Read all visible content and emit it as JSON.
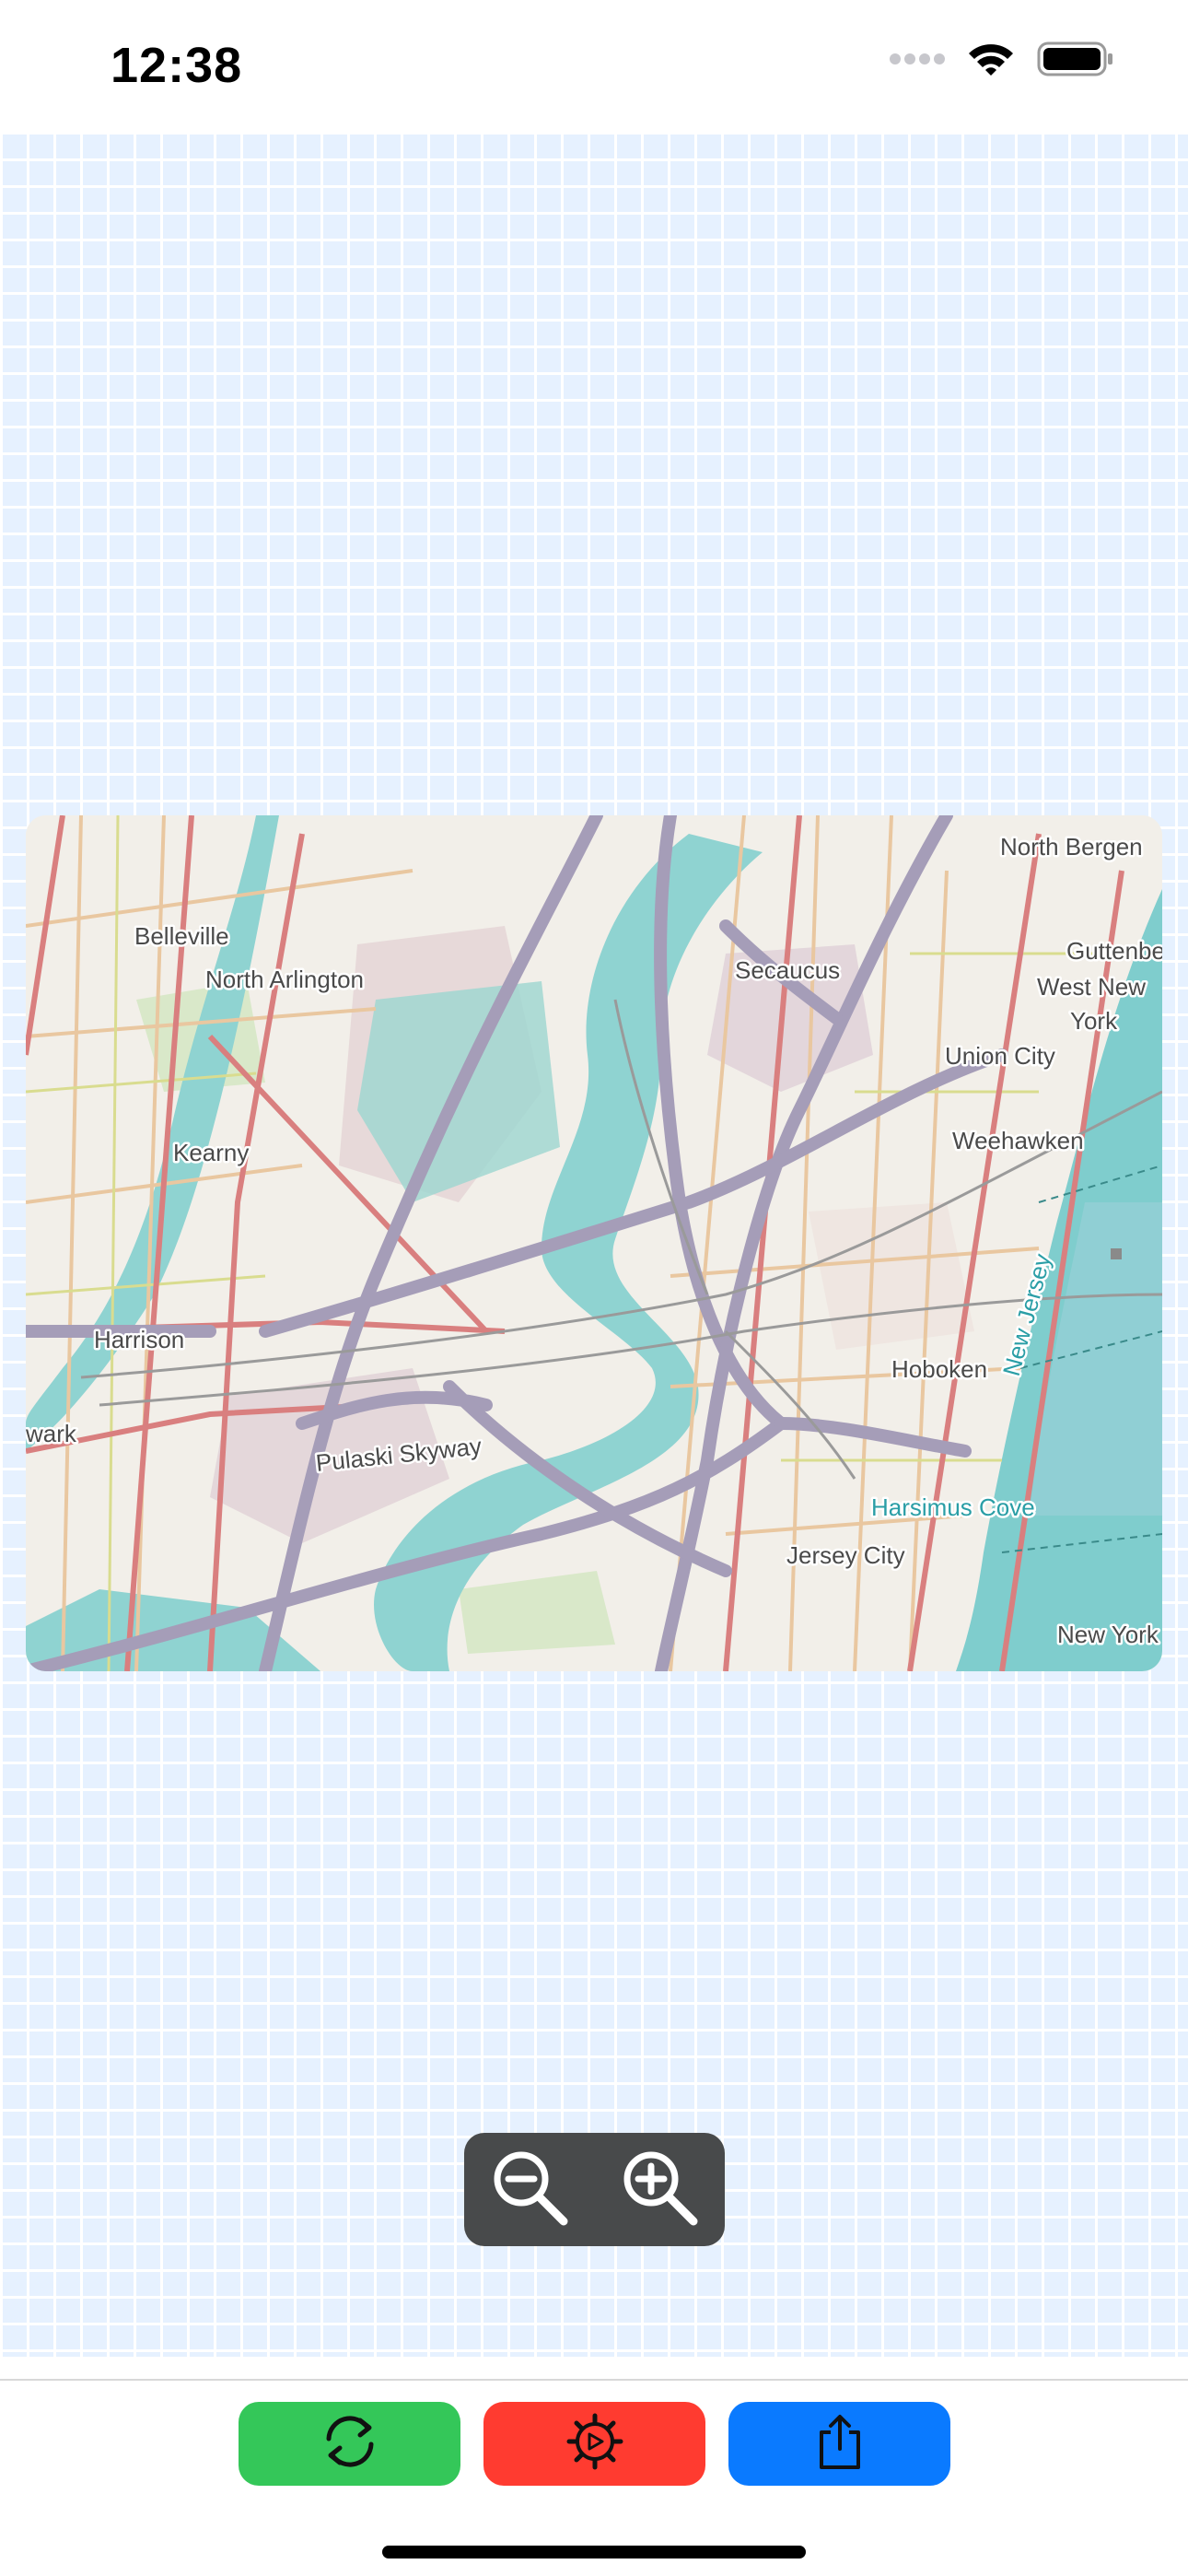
{
  "status_bar": {
    "time": "12:38",
    "icons": [
      "signal-icon",
      "wifi-icon",
      "battery-icon"
    ]
  },
  "map": {
    "labels": {
      "north_bergen": "North Bergen",
      "belleville": "Belleville",
      "north_arlington": "North Arlington",
      "secaucus": "Secaucus",
      "guttenberg": "Guttenbe",
      "west_new_york_1": "West New",
      "west_new_york_2": "York",
      "union_city": "Union City",
      "kearny": "Kearny",
      "weehawken": "Weehawken",
      "harrison": "Harrison",
      "hoboken": "Hoboken",
      "new_jersey": "New Jersey",
      "newark": "wark",
      "pulaski_skyway": "Pulaski Skyway",
      "harsimus_cove": "Harsimus Cove",
      "jersey_city": "Jersey City",
      "new_york": "New York"
    }
  },
  "zoom_controls": {
    "zoom_out_icon": "zoom-out-icon",
    "zoom_in_icon": "zoom-in-icon"
  },
  "toolbar": {
    "buttons": [
      {
        "name": "refresh-button",
        "icon": "refresh-icon",
        "color": "#34c759"
      },
      {
        "name": "settings-button",
        "icon": "gear-icon",
        "color": "#ff3b30"
      },
      {
        "name": "share-button",
        "icon": "share-icon",
        "color": "#0a7aff"
      }
    ]
  },
  "colors": {
    "grid_background": "#e6f1ff",
    "zoom_pill": "#484a4b",
    "water": "#7fcdcd",
    "highway": "#a59db8"
  }
}
